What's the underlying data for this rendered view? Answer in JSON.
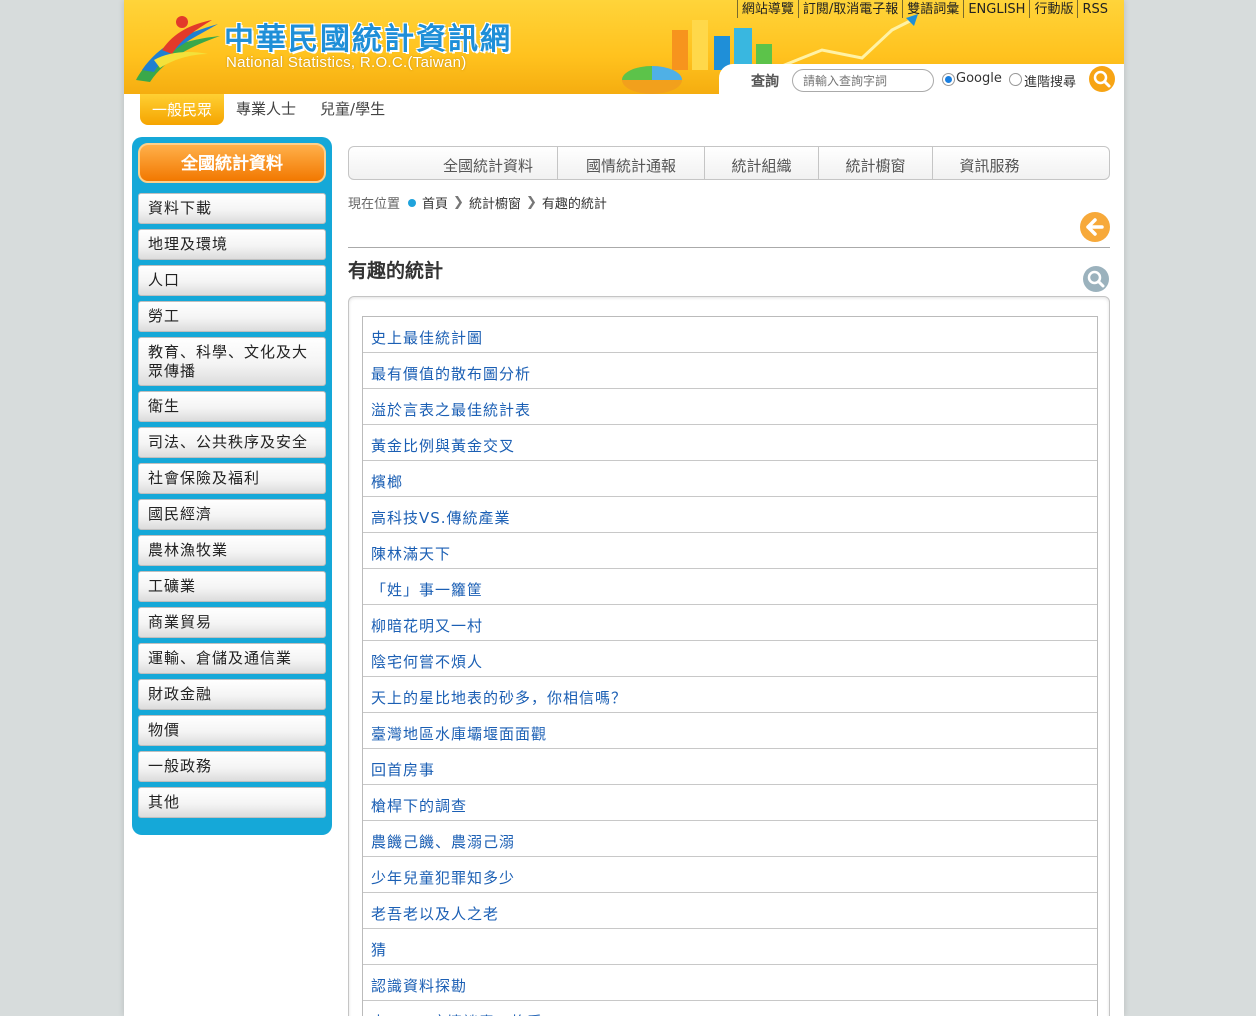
{
  "header": {
    "title": "中華民國統計資訊網",
    "subtitle": "National Statistics, R.O.C.(Taiwan)",
    "top_links": [
      "網站導覽",
      "訂閱/取消電子報",
      "雙語詞彙",
      "ENGLISH",
      "行動版",
      "RSS"
    ]
  },
  "search": {
    "label": "查詢",
    "placeholder": "請輸入查詢字詞",
    "options": [
      "Google",
      "進階搜尋"
    ],
    "selected": "Google",
    "button_icon": "search-icon"
  },
  "audience_tabs": [
    "一般民眾",
    "專業人士",
    "兒童/學生"
  ],
  "audience_active": "一般民眾",
  "sidebar": {
    "title": "全國統計資料",
    "items": [
      "資料下載",
      "地理及環境",
      "人口",
      "勞工",
      "教育、科學、文化及大眾傳播",
      "衛生",
      "司法、公共秩序及安全",
      "社會保險及福利",
      "國民經濟",
      "農林漁牧業",
      "工礦業",
      "商業貿易",
      "運輸、倉儲及通信業",
      "財政金融",
      "物價",
      "一般政務",
      "其他"
    ]
  },
  "main_nav": [
    "全國統計資料",
    "國情統計通報",
    "統計組織",
    "統計櫥窗",
    "資訊服務"
  ],
  "breadcrumb": {
    "label": "現在位置",
    "items": [
      "首頁",
      "統計櫥窗",
      "有趣的統計"
    ]
  },
  "page_title": "有趣的統計",
  "items": [
    "史上最佳統計圖",
    "最有價值的散布圖分析",
    "溢於言表之最佳統計表",
    "黃金比例與黃金交叉",
    "檳榔",
    "高科技VS.傳統產業",
    "陳林滿天下",
    "「姓」事一籮筐",
    "柳暗花明又一村",
    "陰宅何嘗不煩人",
    "天上的星比地表的砂多，你相信嗎？",
    "臺灣地區水庫壩堰面面觀",
    "回首房事",
    "槍桿下的調查",
    "農饑己饑、農溺己溺",
    "少年兒童犯罪知多少",
    "老吾老以及人之老",
    "猜",
    "認識資料探勘",
    "由SARS疫情談責工格爭"
  ],
  "colors": {
    "header_yellow": "#ffc21e",
    "sidebar_blue": "#15a8d8",
    "sidebar_title_orange": "#f27800",
    "link_blue": "#1b5fb4",
    "accent_orange": "#f7a414"
  }
}
